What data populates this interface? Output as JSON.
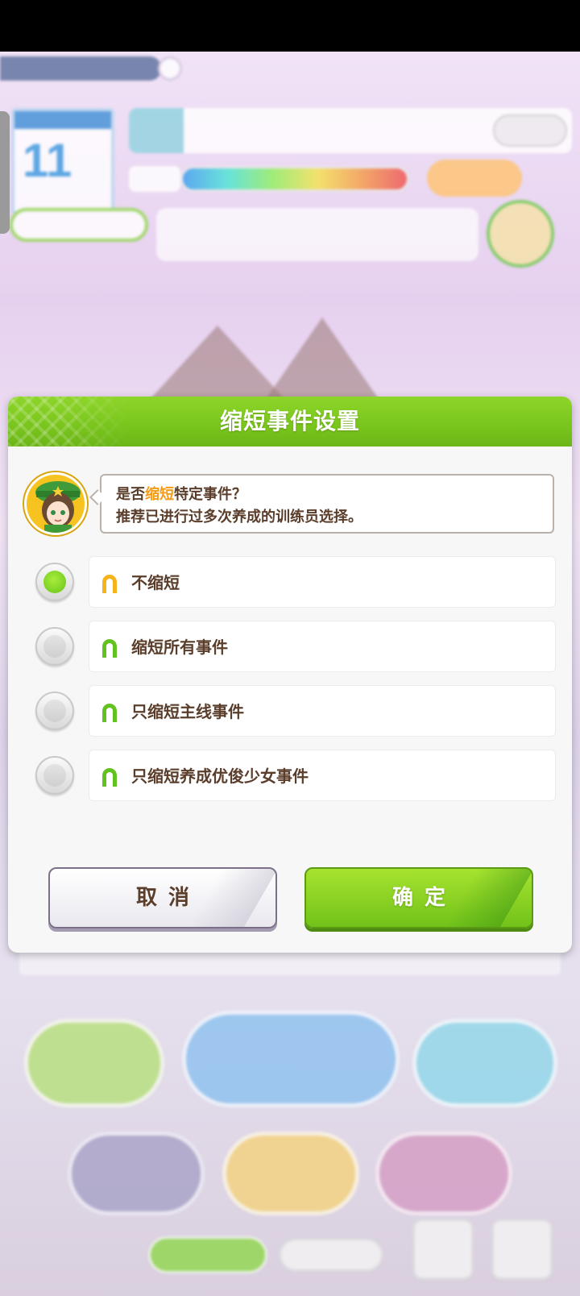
{
  "dialog": {
    "title": "缩短事件设置",
    "speech": {
      "line1_prefix": "是否",
      "line1_highlight": "缩短",
      "line1_suffix": "特定事件？",
      "line2": "推荐已进行过多次养成的训练员选择。"
    },
    "options": [
      {
        "label": "不缩短",
        "selected": true,
        "icon": "horseshoe-icon",
        "icon_color": "#f5b41c"
      },
      {
        "label": "缩短所有事件",
        "selected": false,
        "icon": "horseshoe-icon",
        "icon_color": "#62c21f"
      },
      {
        "label": "只缩短主线事件",
        "selected": false,
        "icon": "horseshoe-icon",
        "icon_color": "#62c21f"
      },
      {
        "label": "只缩短养成优俊少女事件",
        "selected": false,
        "icon": "horseshoe-icon",
        "icon_color": "#62c21f"
      }
    ],
    "buttons": {
      "cancel": "取消",
      "confirm": "确定"
    }
  },
  "colors": {
    "header_green": "#79c51d",
    "text_brown": "#5a3e2b",
    "highlight_orange": "#f49b18"
  }
}
